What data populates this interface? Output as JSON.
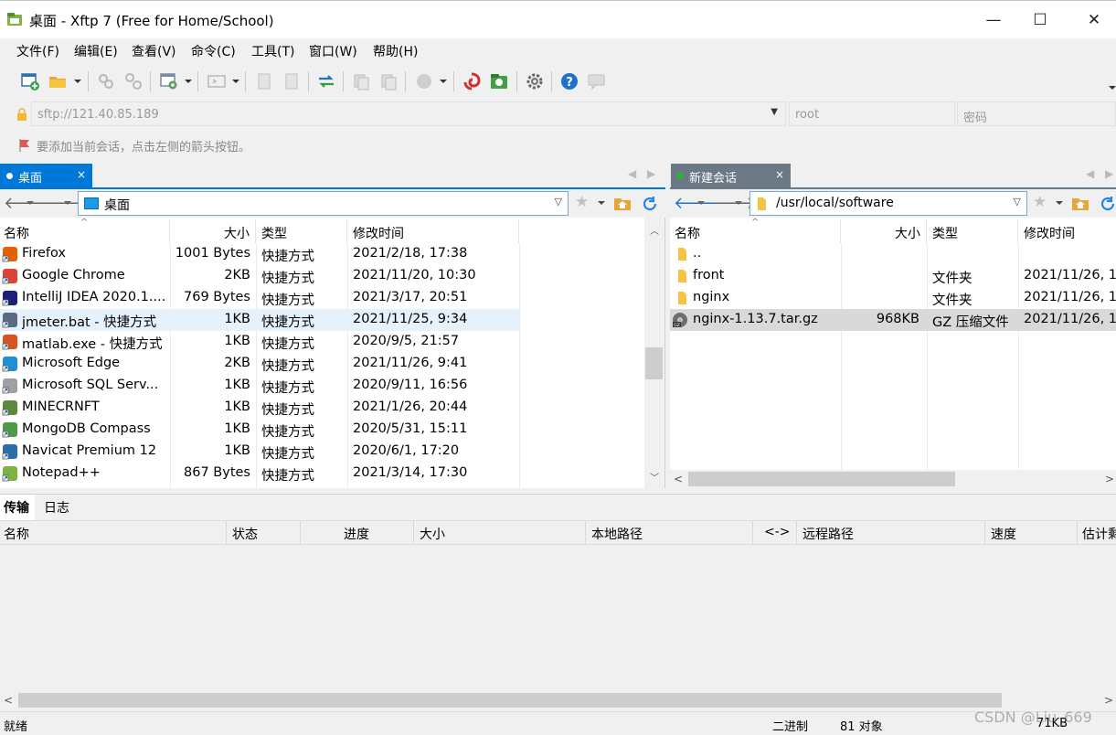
{
  "window": {
    "title": "桌面 - Xftp 7 (Free for Home/School)",
    "minimize": "—",
    "maximize": "☐",
    "close": "✕"
  },
  "menu": [
    "文件(F)",
    "编辑(E)",
    "查看(V)",
    "命令(C)",
    "工具(T)",
    "窗口(W)",
    "帮助(H)"
  ],
  "address": {
    "host": "sftp://121.40.85.189",
    "user": "root",
    "password_placeholder": "密码"
  },
  "hint": "要添加当前会话，点击左侧的箭头按钮。",
  "tabs": {
    "local": {
      "label": "桌面",
      "close": "×"
    },
    "remote": {
      "label": "新建会话",
      "close": "×"
    }
  },
  "local_panel": {
    "path": "桌面",
    "columns": {
      "name": "名称",
      "size": "大小",
      "type": "类型",
      "mtime": "修改时间"
    },
    "rows": [
      {
        "name": "Firefox",
        "size": "1001 Bytes",
        "type": "快捷方式",
        "mtime": "2021/2/18, 17:38",
        "icon": "firefox-icon",
        "color": "#e66000"
      },
      {
        "name": "Google Chrome",
        "size": "2KB",
        "type": "快捷方式",
        "mtime": "2021/11/20, 10:30",
        "icon": "chrome-icon",
        "color": "#db4437"
      },
      {
        "name": "IntelliJ IDEA 2020.1....",
        "size": "769 Bytes",
        "type": "快捷方式",
        "mtime": "2021/3/17, 20:51",
        "icon": "intellij-icon",
        "color": "#1f1f7a"
      },
      {
        "name": "jmeter.bat - 快捷方式",
        "size": "1KB",
        "type": "快捷方式",
        "mtime": "2021/11/25, 9:34",
        "icon": "batch-file-icon",
        "color": "#5a6a80"
      },
      {
        "name": "matlab.exe - 快捷方式",
        "size": "1KB",
        "type": "快捷方式",
        "mtime": "2020/9/5, 21:57",
        "icon": "matlab-icon",
        "color": "#d9531e"
      },
      {
        "name": "Microsoft Edge",
        "size": "2KB",
        "type": "快捷方式",
        "mtime": "2021/11/26, 9:41",
        "icon": "edge-icon",
        "color": "#1f8fd6"
      },
      {
        "name": "Microsoft SQL Serv...",
        "size": "1KB",
        "type": "快捷方式",
        "mtime": "2020/9/11, 16:56",
        "icon": "sql-server-icon",
        "color": "#a0a0a0"
      },
      {
        "name": "MINECRNFT",
        "size": "1KB",
        "type": "快捷方式",
        "mtime": "2021/1/26, 20:44",
        "icon": "minecraft-icon",
        "color": "#5b8a3c"
      },
      {
        "name": "MongoDB Compass",
        "size": "1KB",
        "type": "快捷方式",
        "mtime": "2020/5/31, 15:11",
        "icon": "mongodb-icon",
        "color": "#4f9a47"
      },
      {
        "name": "Navicat Premium 12",
        "size": "1KB",
        "type": "快捷方式",
        "mtime": "2020/6/1, 17:20",
        "icon": "navicat-icon",
        "color": "#2d6ea8"
      },
      {
        "name": "Notepad++",
        "size": "867 Bytes",
        "type": "快捷方式",
        "mtime": "2021/3/14, 17:30",
        "icon": "notepadpp-icon",
        "color": "#7cb342"
      }
    ]
  },
  "remote_panel": {
    "path": "/usr/local/software",
    "columns": {
      "name": "名称",
      "size": "大小",
      "type": "类型",
      "mtime": "修改时间"
    },
    "rows": [
      {
        "name": "..",
        "size": "",
        "type": "",
        "mtime": ""
      },
      {
        "name": "front",
        "size": "",
        "type": "文件夹",
        "mtime": "2021/11/26, 1"
      },
      {
        "name": "nginx",
        "size": "",
        "type": "文件夹",
        "mtime": "2021/11/26, 1"
      },
      {
        "name": "nginx-1.13.7.tar.gz",
        "size": "968KB",
        "type": "GZ 压缩文件",
        "mtime": "2021/11/26, 1"
      }
    ]
  },
  "bottom_tabs": [
    "传输",
    "日志"
  ],
  "transfer_columns": [
    "名称",
    "状态",
    "进度",
    "大小",
    "本地路径",
    "<->",
    "远程路径",
    "速度",
    "估计剩"
  ],
  "status": {
    "left": "就绪",
    "mode": "二进制",
    "objects": "81 对象",
    "size": "71KB"
  },
  "watermark": "CSDN @Liu_669",
  "colors": {
    "accent": "#0078d7",
    "tab_inactive": "#6b7886",
    "selected_row": "#e5f1fb",
    "selected_row_remote": "#d9d9d9",
    "folder": "#f5c342",
    "connected_dot": "#22bb22"
  }
}
